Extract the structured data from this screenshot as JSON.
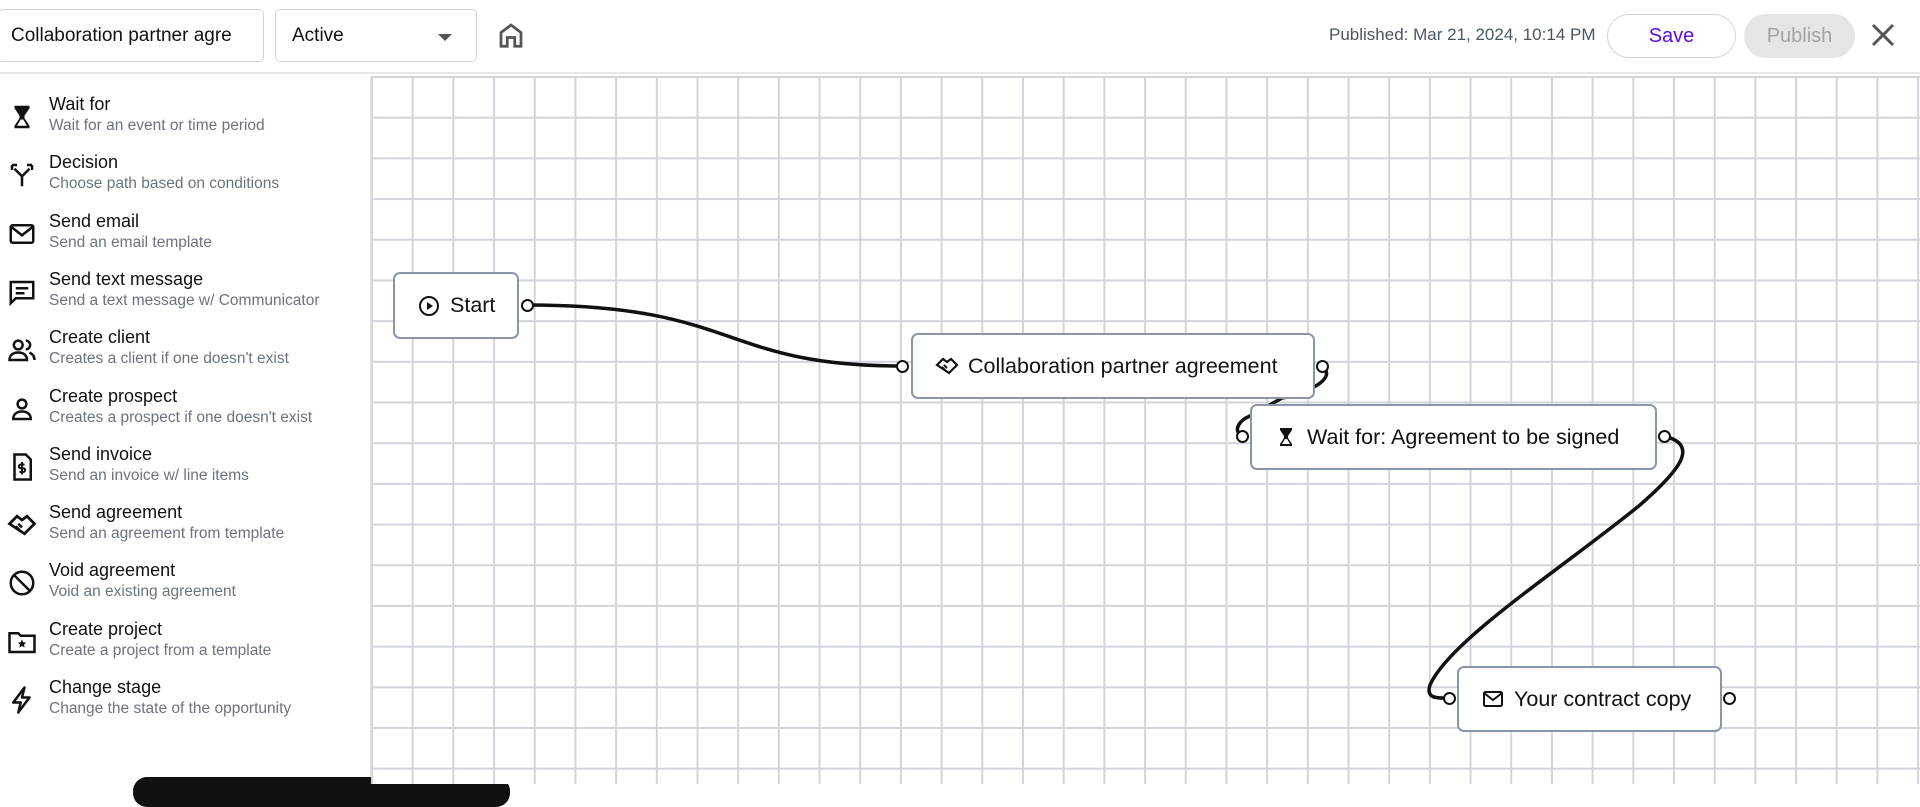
{
  "header": {
    "title_value": "Collaboration partner agre",
    "status": "Active",
    "published": "Published: Mar 21, 2024, 10:14 PM",
    "save_label": "Save",
    "publish_label": "Publish",
    "publish_disabled": true,
    "accent": "#5b0fe0"
  },
  "sidebar": {
    "items": [
      {
        "icon": "hourglass-icon",
        "title": "Wait for",
        "subtitle": "Wait for an event or time period"
      },
      {
        "icon": "split-arrows-icon",
        "title": "Decision",
        "subtitle": "Choose path based on conditions"
      },
      {
        "icon": "envelope-icon",
        "title": "Send email",
        "subtitle": "Send an email template"
      },
      {
        "icon": "message-icon",
        "title": "Send text message",
        "subtitle": "Send a text message w/ Communicator"
      },
      {
        "icon": "users-icon",
        "title": "Create client",
        "subtitle": "Creates a client if one doesn't exist"
      },
      {
        "icon": "user-icon",
        "title": "Create prospect",
        "subtitle": "Creates a prospect if one doesn't exist"
      },
      {
        "icon": "invoice-icon",
        "title": "Send invoice",
        "subtitle": "Send an invoice w/ line items"
      },
      {
        "icon": "handshake-icon",
        "title": "Send agreement",
        "subtitle": "Send an agreement from template"
      },
      {
        "icon": "ban-icon",
        "title": "Void agreement",
        "subtitle": "Void an existing agreement"
      },
      {
        "icon": "folder-star-icon",
        "title": "Create project",
        "subtitle": "Create a project from a template"
      },
      {
        "icon": "lightning-icon",
        "title": "Change stage",
        "subtitle": "Change the state of the opportunity"
      }
    ]
  },
  "canvas": {
    "nodes": [
      {
        "icon": "play-circle-icon",
        "label": "Start"
      },
      {
        "icon": "handshake-icon",
        "label": "Collaboration partner agreement"
      },
      {
        "icon": "hourglass-icon",
        "label": "Wait for: Agreement to be signed"
      },
      {
        "icon": "envelope-icon",
        "label": "Your contract copy"
      }
    ]
  }
}
